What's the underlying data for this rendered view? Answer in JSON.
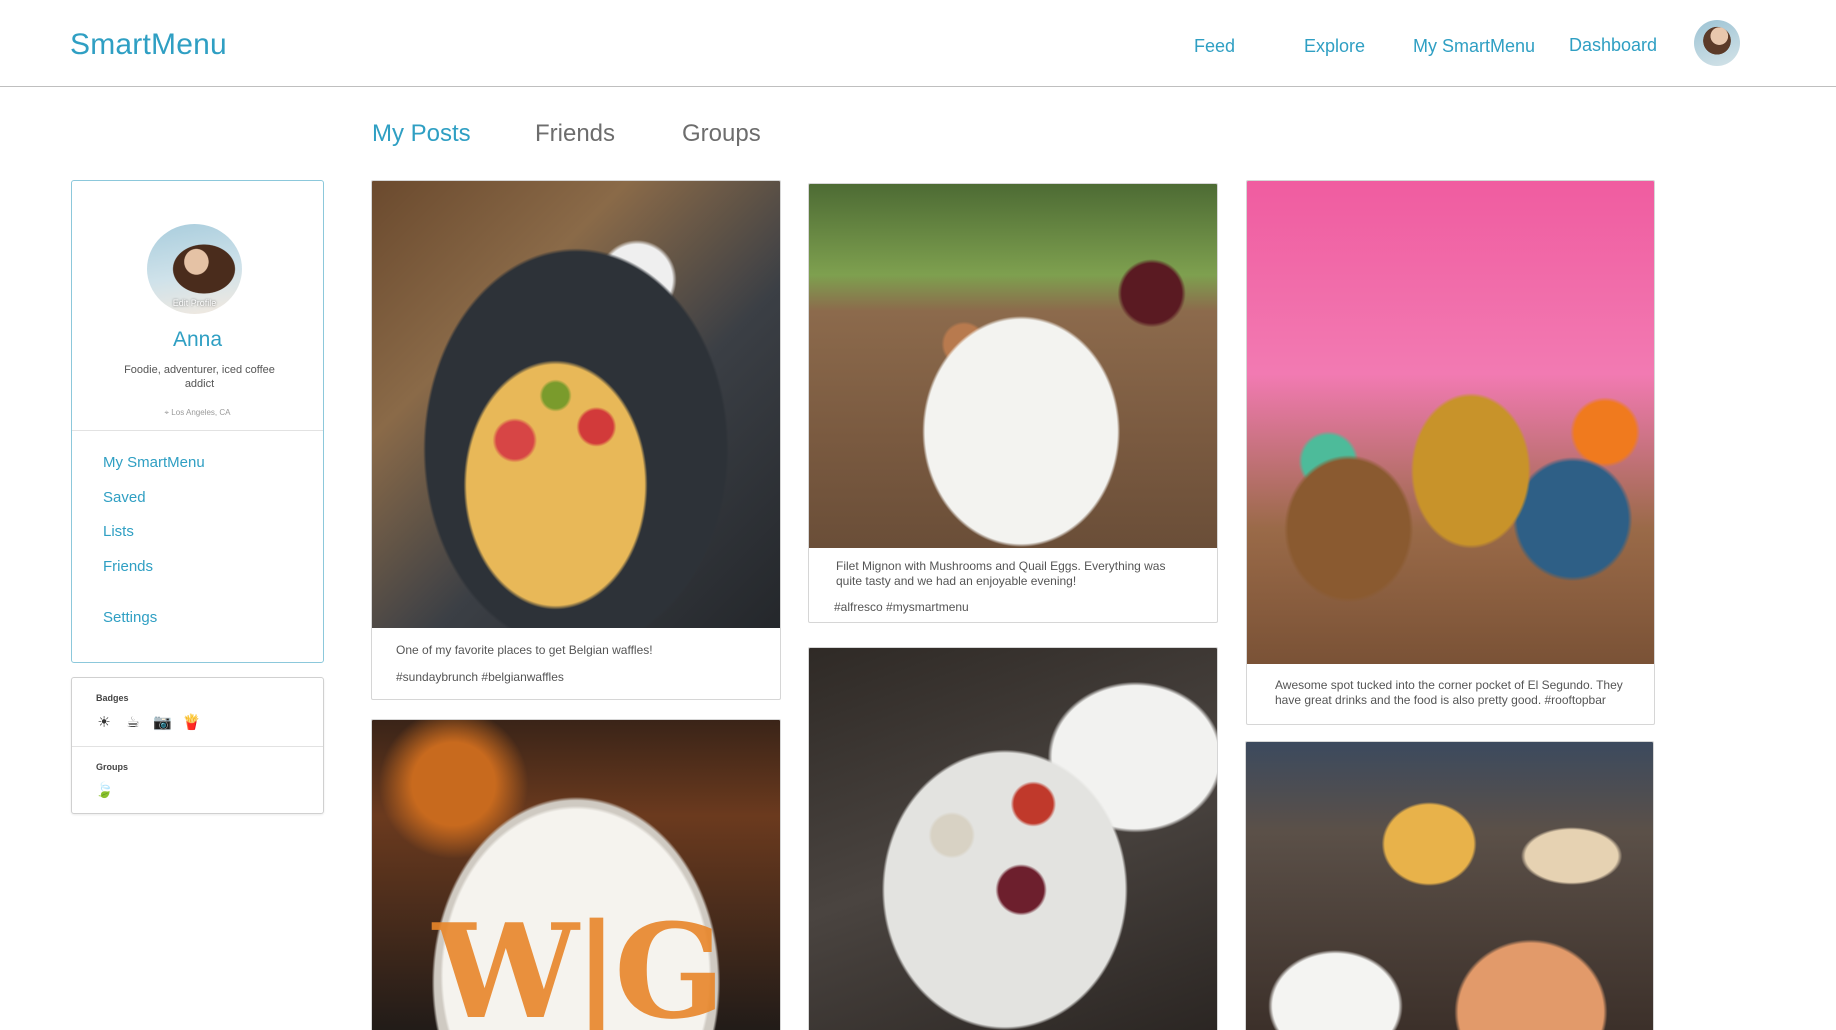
{
  "header": {
    "brand": "SmartMenu",
    "nav": [
      "Feed",
      "Explore",
      "My SmartMenu",
      "Dashboard"
    ]
  },
  "tabs": [
    "My Posts",
    "Friends",
    "Groups"
  ],
  "profile": {
    "edit_label": "Edit Profile",
    "name": "Anna",
    "bio": "Foodie, adventurer, iced coffee addict",
    "location": "Los Angeles, CA",
    "links": [
      "My SmartMenu",
      "Saved",
      "Lists",
      "Friends",
      "Settings"
    ]
  },
  "badges": {
    "label": "Badges",
    "items": [
      "☀",
      "☕",
      "📷",
      "🍟"
    ],
    "groups_label": "Groups",
    "groups_items": [
      "🍃"
    ]
  },
  "posts": [
    {
      "caption": "One of my favorite places to get Belgian waffles!",
      "tags": "#sundaybrunch #belgianwaffles"
    },
    {
      "caption": "Filet Mignon with Mushrooms and Quail Eggs. Everything was quite tasty and we had an enjoyable evening!",
      "tags": "#alfresco #mysmartmenu"
    },
    {
      "caption": "Awesome spot tucked into the corner pocket of El Segundo. They have great drinks and the food is also pretty good. #rooftopbar",
      "tags": ""
    },
    {
      "latte_art": "W|G"
    }
  ],
  "colors": {
    "accent": "#2f9fc3",
    "border": "#8cc8db"
  }
}
